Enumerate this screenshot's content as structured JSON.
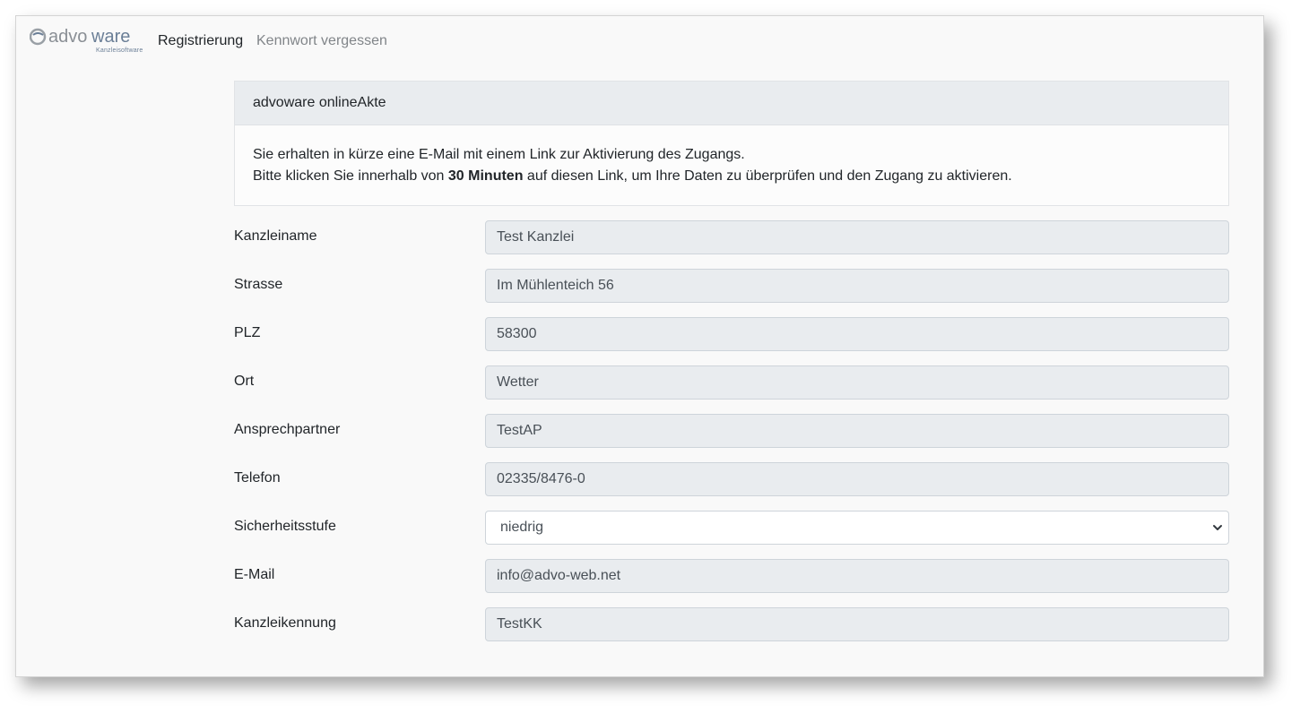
{
  "nav": {
    "logo_text_left": "advo",
    "logo_text_right": "ware",
    "logo_tagline": "Kanzleisoftware",
    "links": [
      {
        "label": "Registrierung",
        "active": true
      },
      {
        "label": "Kennwort vergessen",
        "active": false
      }
    ]
  },
  "card": {
    "header": "advoware onlineAkte",
    "line1": "Sie erhalten in kürze eine E-Mail mit einem Link zur Aktivierung des Zugangs.",
    "line2_before": "Bitte klicken Sie innerhalb von ",
    "line2_bold": "30 Minuten",
    "line2_after": " auf diesen Link, um Ihre Daten zu überprüfen und den Zugang zu aktivieren."
  },
  "form": {
    "fields": [
      {
        "label": "Kanzleiname",
        "value": "Test Kanzlei"
      },
      {
        "label": "Strasse",
        "value": "Im Mühlenteich 56"
      },
      {
        "label": "PLZ",
        "value": "58300"
      },
      {
        "label": "Ort",
        "value": "Wetter"
      },
      {
        "label": "Ansprechpartner",
        "value": "TestAP"
      },
      {
        "label": "Telefon",
        "value": "02335/8476-0"
      },
      {
        "label": "Sicherheitsstufe",
        "value": "niedrig"
      },
      {
        "label": "E-Mail",
        "value": "info@advo-web.net"
      },
      {
        "label": "Kanzleikennung",
        "value": "TestKK"
      }
    ]
  },
  "colors": {
    "page_bg": "#f9f9f9",
    "readonly_bg": "#e9ecef",
    "logo_gray": "#8a8f95",
    "logo_blue": "#6b7f97"
  }
}
